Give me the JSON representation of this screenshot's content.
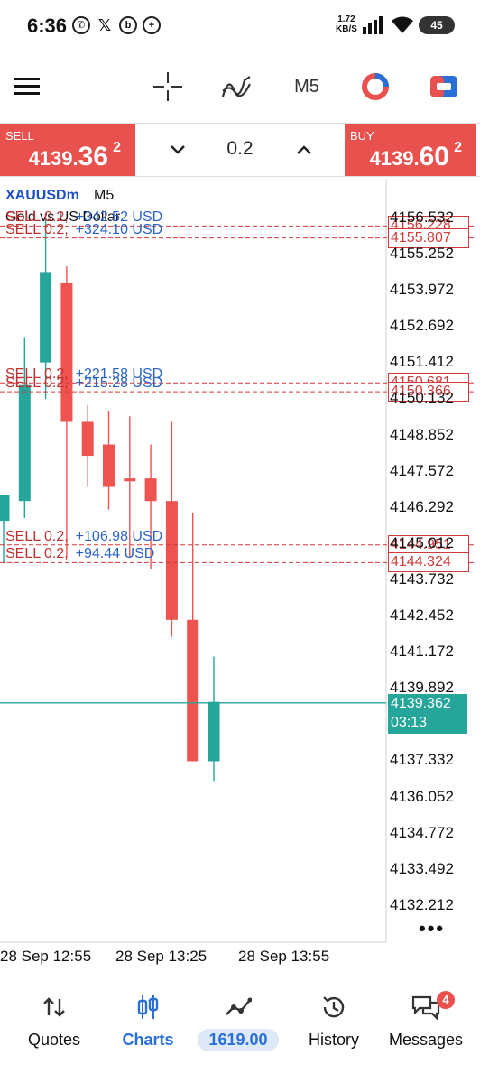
{
  "status": {
    "time": "6:36",
    "speed_value": "1.72",
    "speed_unit": "KB/S",
    "battery": "45"
  },
  "toolbar": {
    "timeframe": "M5"
  },
  "trade": {
    "sell_label": "SELL",
    "sell_price_main": "4139.",
    "sell_price_big": "36",
    "sell_price_sup": "2",
    "buy_label": "BUY",
    "buy_price_main": "4139.",
    "buy_price_big": "60",
    "buy_price_sup": "2",
    "volume": "0.2"
  },
  "chart": {
    "symbol": "XAUUSDm",
    "timeframe": "M5",
    "description": "Gold vs US Dollar",
    "current_price": "4139.362",
    "countdown": "03:13",
    "axis_labels": [
      "4156.532",
      "4155.252",
      "4153.972",
      "4152.692",
      "4151.412",
      "4150.132",
      "4148.852",
      "4147.572",
      "4146.292",
      "4145.012",
      "4143.732",
      "4142.452",
      "4141.172",
      "4139.892",
      "4137.332",
      "4136.052",
      "4134.772",
      "4133.492",
      "4132.212"
    ],
    "orders": [
      {
        "side": "SELL 0.2,",
        "pl": "+342.52 USD",
        "price": "4156.228"
      },
      {
        "side": "SELL 0.2,",
        "pl": "+324.10 USD",
        "price": "4155.807"
      },
      {
        "side": "SELL 0.2,",
        "pl": "+221.58 USD",
        "price": "4150.681"
      },
      {
        "side": "SELL 0.2,",
        "pl": "+215.28 USD",
        "price": "4150.366"
      },
      {
        "side": "SELL 0.2,",
        "pl": "+106.98 USD",
        "price": "4144.951"
      },
      {
        "side": "SELL 0.2,",
        "pl": "+94.44 USD",
        "price": "4144.324"
      }
    ],
    "time_labels": [
      "28 Sep 12:55",
      "28 Sep 13:25",
      "28 Sep 13:55"
    ]
  },
  "chart_data": {
    "type": "candlestick",
    "ylim": [
      4130.9,
      4157.9
    ],
    "candles": [
      {
        "o": 4145.8,
        "h": 4146.5,
        "l": 4144.3,
        "c": 4146.7,
        "dir": "up"
      },
      {
        "o": 4146.5,
        "h": 4152.3,
        "l": 4145.9,
        "c": 4150.6,
        "dir": "up"
      },
      {
        "o": 4151.4,
        "h": 4156.5,
        "l": 4150.1,
        "c": 4154.6,
        "dir": "up"
      },
      {
        "o": 4154.2,
        "h": 4154.8,
        "l": 4144.5,
        "c": 4149.3,
        "dir": "down"
      },
      {
        "o": 4149.3,
        "h": 4149.9,
        "l": 4147.0,
        "c": 4148.1,
        "dir": "down"
      },
      {
        "o": 4148.5,
        "h": 4149.7,
        "l": 4146.2,
        "c": 4147.0,
        "dir": "down"
      },
      {
        "o": 4147.3,
        "h": 4149.5,
        "l": 4144.5,
        "c": 4147.2,
        "dir": "down"
      },
      {
        "o": 4147.3,
        "h": 4148.5,
        "l": 4144.1,
        "c": 4146.5,
        "dir": "down"
      },
      {
        "o": 4146.5,
        "h": 4149.3,
        "l": 4141.7,
        "c": 4142.3,
        "dir": "down"
      },
      {
        "o": 4142.3,
        "h": 4146.1,
        "l": 4137.3,
        "c": 4137.3,
        "dir": "down"
      },
      {
        "o": 4137.3,
        "h": 4141.0,
        "l": 4136.6,
        "c": 4139.4,
        "dir": "up"
      }
    ]
  },
  "nav": {
    "quotes": "Quotes",
    "charts": "Charts",
    "balance": "1619.00",
    "history": "History",
    "messages": "Messages",
    "messages_badge": "4"
  },
  "colors": {
    "bear": "#ef5350",
    "bull": "#26a69a",
    "sell_box": "#e8514e",
    "accent": "#2a6fd6"
  }
}
